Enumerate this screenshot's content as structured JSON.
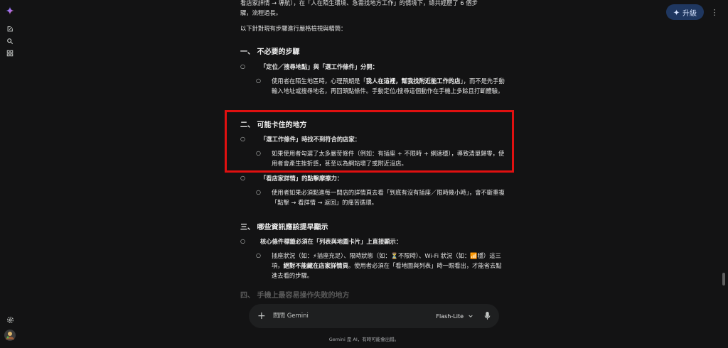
{
  "header": {
    "upgrade_label": "升級"
  },
  "content": {
    "p_top_line1": "看店家詳情 → 導航），在「人在陌生環境、急需找地方工作」的情境下，總共經歷了 6 個步",
    "p_top_line2": "驟，流程過長。",
    "intro": "以下針對現有步驟進行嚴格檢視與精簡：",
    "s1": {
      "heading": "一、 不必要的步驟",
      "items": [
        {
          "label": "「定位／搜尋地點」與「選工作條件」分開：",
          "sub": {
            "a": "使用者在陌生地區時，心理預期是「",
            "b": "我人在這裡，幫我找附近能工作的店",
            "c": "」，而不是先手動輸入地址或搜尋地名，再回頭點條件。手動定位/搜尋這個動作在手機上多餘且打斷體驗。"
          }
        }
      ]
    },
    "s2": {
      "heading": "二、 可能卡住的地方",
      "items": [
        {
          "label": "「選工作條件」時找不到符合的店家：",
          "sub": "如果使用者勾選了太多嚴苛條件（例如：有插座 + 不限時 + 網速穩），導致清單歸零，使用者會產生挫折感，甚至以為網站壞了或附近沒店。"
        },
        {
          "label": "「看店家詳情」的點擊摩擦力：",
          "sub": "使用者如果必須點進每一間店的詳情頁去看「到底有沒有插座／限時幾小時」，會不斷重複「點擊 → 看詳情 → 返回」的痛苦循環。"
        }
      ]
    },
    "s3": {
      "heading": "三、 哪些資訊應該提早顯示",
      "items": [
        {
          "label": "核心條件標籤必須在「列表與地圖卡片」上直接顯示：",
          "sub": {
            "a": "插座狀況（如：",
            "emoji1": "⚡",
            "b": "插座充足）、限時狀態（如：",
            "emoji2": "⏳",
            "c": "不限時）、Wi-Fi 狀況（如：",
            "emoji3": "📶",
            "d": "穩）這三項，",
            "e": "絕對不能藏在店家詳情頁",
            "f": "。使用者必須在「看地圖與列表」時一眼看出，才能省去點進去看的步驟。"
          }
        }
      ]
    },
    "s4_heading_partial": "四、 手機上最容易操作失敗的地方"
  },
  "input": {
    "placeholder": "問問 Gemini",
    "model_label": "Flash-Lite"
  },
  "footer": {
    "disclaimer": "Gemini 是 AI，有時可能會出錯。"
  },
  "icons": [
    "gemini-sparkle-icon",
    "new-chat-icon",
    "search-icon",
    "apps-icon",
    "settings-icon",
    "avatar",
    "plus-icon",
    "chevron-down-icon",
    "mic-icon",
    "kebab-menu-icon"
  ]
}
